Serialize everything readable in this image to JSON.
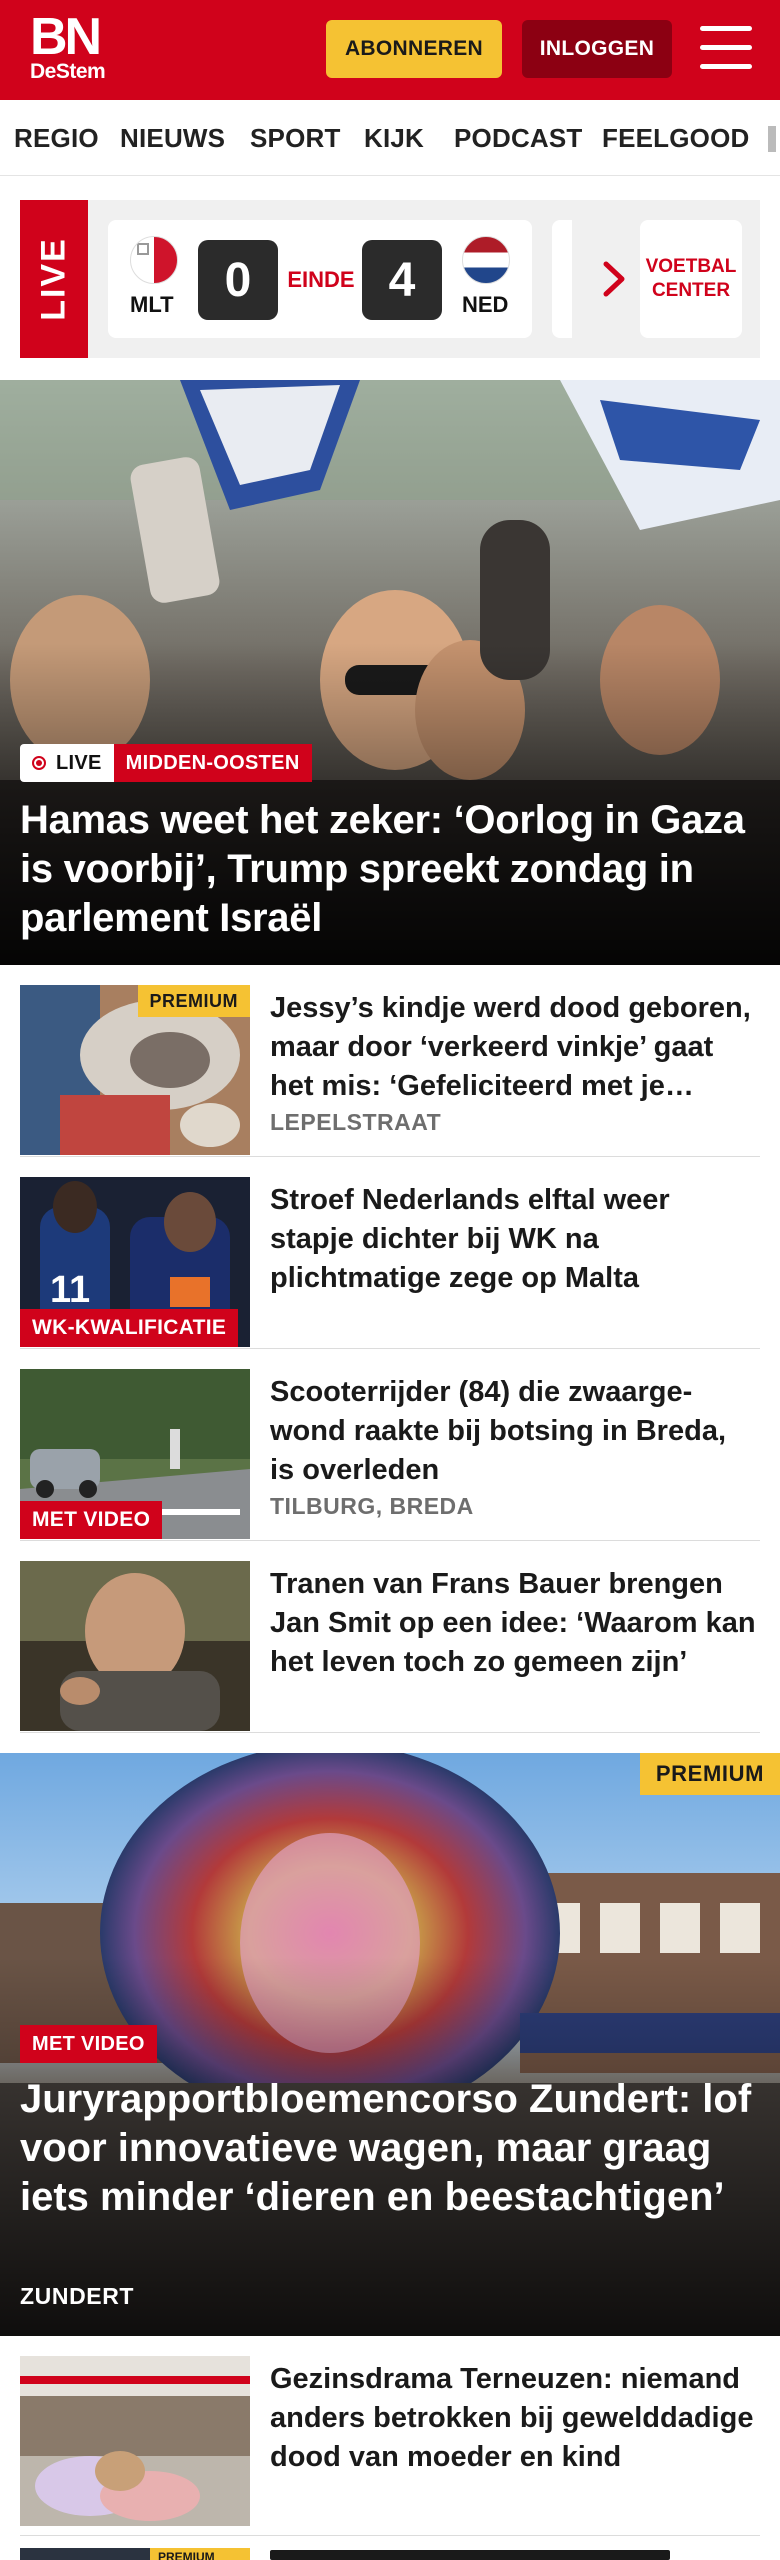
{
  "header": {
    "logo_line1": "BN",
    "logo_line2": "DeStem",
    "subscribe_label": "ABONNEREN",
    "login_label": "INLOGGEN",
    "menu_icon": "hamburger-menu-icon",
    "brand_color": "#d0021b",
    "accent_color": "#f5c233"
  },
  "nav": {
    "items": [
      "REGIO",
      "NIEUWS",
      "SPORT",
      "KIJK",
      "PODCAST",
      "FEELGOOD"
    ]
  },
  "live_widget": {
    "label": "LIVE",
    "match": {
      "home_team": "MLT",
      "away_team": "NED",
      "home_score": "0",
      "away_score": "4",
      "status": "EINDE"
    },
    "next_icon": "chevron-right-icon",
    "center_button": "VOETBAL CENTER"
  },
  "hero": {
    "live_tag": "LIVE",
    "category": "MIDDEN-OOSTEN",
    "title": "Hamas weet het zeker: ‘Oorlog in Gaza is voorbij’, Trump spreekt zondag in parlement Israël"
  },
  "articles": [
    {
      "title": "Jessy’s kindje werd dood geboren, maar door ‘verkeerd vinkje’ gaat het mis: ‘Gefelicite­erd met je kindje’",
      "badge": "PREMIUM",
      "tag": "",
      "meta": "LEPELSTRAAT"
    },
    {
      "title": "Stroef Nederlands elftal weer stapje dichter bij WK na plichtmatige zege op Malta",
      "badge": "",
      "tag": "WK-KWALIFICATIE",
      "meta": ""
    },
    {
      "title": "Scooterrijder (84) die zwaarge­wond raakte bij botsing in Breda, is overleden",
      "badge": "",
      "tag": "MET VIDEO",
      "meta": "TILBURG, BREDA"
    },
    {
      "title": "Tranen van Frans Bauer brengen Jan Smit op een idee: ‘Waarom kan het leven toch zo gemeen zijn’",
      "badge": "",
      "tag": "",
      "meta": ""
    }
  ],
  "feature": {
    "badge": "PREMIUM",
    "tag": "MET VIDEO",
    "title": "Juryrapportbloemencorso Zundert: lof voor innovatieve wagen, maar graag iets minder ‘dieren en beestachtigen’",
    "meta": "ZUNDERT"
  },
  "article_after_feature": {
    "title": "Gezinsdrama Terneuzen: niemand anders betrokken bij gewelddadige dood van moeder en kind"
  },
  "peek_badge": "PREMIUM"
}
